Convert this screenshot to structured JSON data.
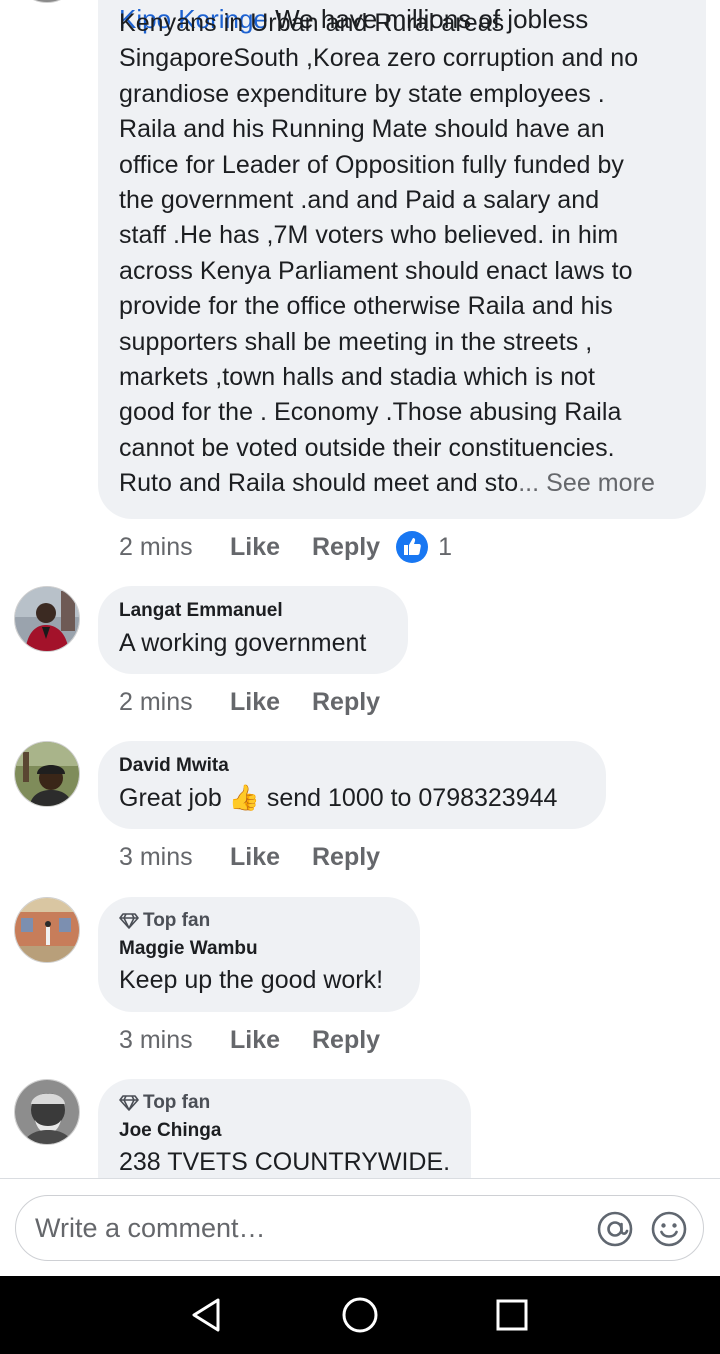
{
  "comments": [
    {
      "author": "Kipo Koringe",
      "cut_text": " We have millions of jobless",
      "lines": [
        "Kenyans in Urban and Rural areas",
        "SingaporeSouth ,Korea zero corruption and no",
        "grandiose expenditure by state employees .",
        "Raila  and his Running Mate should have an",
        "office  for Leader of Opposition fully funded by",
        "the government  .and  and Paid a salary and",
        "staff .He has ,7M voters who believed.  in him",
        "across Kenya  Parliament should enact laws to",
        "provide for the office otherwise Raila and his",
        "supporters shall be meeting in the streets ,",
        "markets ,town halls and stadia which is not",
        "good for the . Economy .Those abusing Raila",
        "cannot be voted outside their constituencies."
      ],
      "last_line": "Ruto and Raila should meet and sto",
      "see_more": "... See more",
      "time": "2 mins",
      "like": "Like",
      "reply": "Reply",
      "reaction_count": "1"
    },
    {
      "author": "Langat Emmanuel",
      "text": "A working government",
      "time": "2 mins",
      "like": "Like",
      "reply": "Reply"
    },
    {
      "author": "David Mwita",
      "text_before": "Great job ",
      "emoji": "👍",
      "text_after": " send 1000 to 0798323944",
      "time": "3 mins",
      "like": "Like",
      "reply": "Reply"
    },
    {
      "badge": "Top fan",
      "author": "Maggie Wambu",
      "text": "Keep up the good work!",
      "time": "3 mins",
      "like": "Like",
      "reply": "Reply"
    },
    {
      "badge": "Top fan",
      "author": "Joe Chinga",
      "text": "238 TVETS COUNTRYWIDE."
    }
  ],
  "composer": {
    "placeholder": "Write a comment…",
    "icons": [
      "at-icon",
      "smiley-icon"
    ]
  },
  "navbar": {
    "icons": [
      "back-triangle-icon",
      "home-circle-icon",
      "recents-square-icon"
    ]
  },
  "colors": {
    "bubble": "#eff1f4",
    "link_blue": "#1d62d1",
    "like_blue": "#1877f2",
    "muted": "#65676b"
  }
}
